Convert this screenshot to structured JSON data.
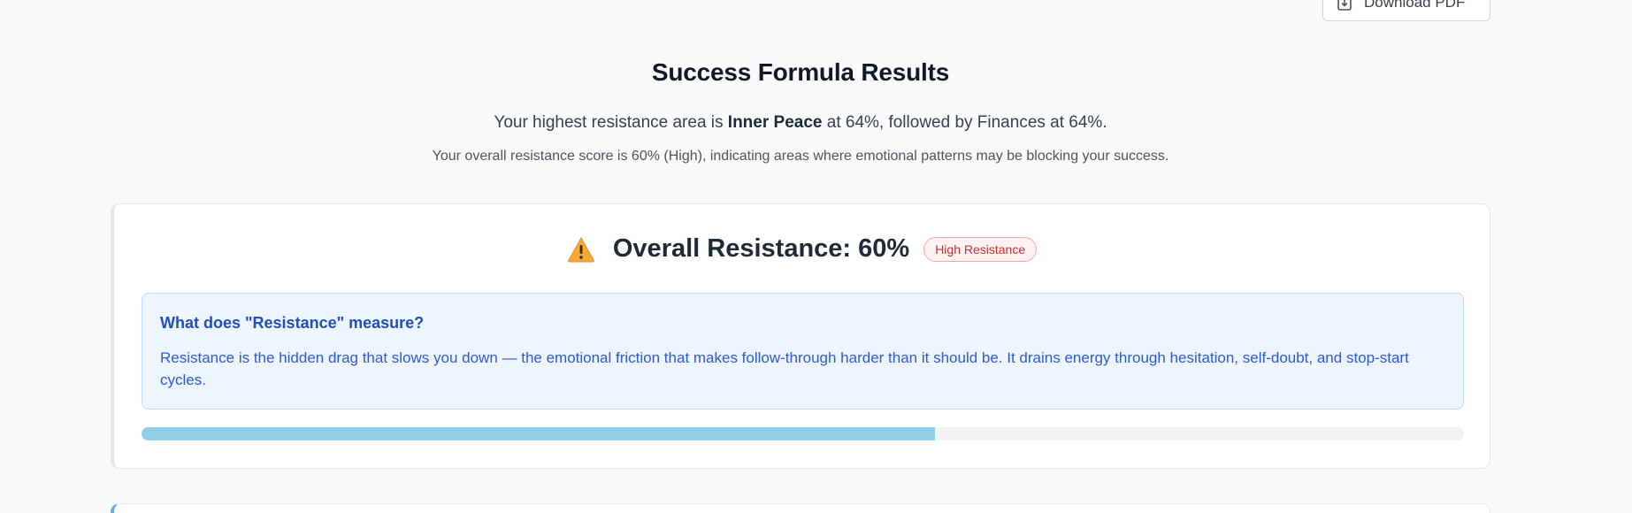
{
  "header": {
    "download_label": "Download PDF",
    "download_icon": "download-icon"
  },
  "results": {
    "title": "Success Formula Results",
    "summary_prefix": "Your highest resistance area is ",
    "summary_highlight": "Inner Peace",
    "summary_suffix": " at 64%, followed by Finances at 64%.",
    "overall_text": "Your overall resistance score is 60% (High), indicating areas where emotional patterns may be blocking your success."
  },
  "resistance_card": {
    "icon": "warning-icon",
    "title": "Overall Resistance: 60%",
    "badge": "High Resistance",
    "badge_color": "#c53030",
    "info_title": "What does \"Resistance\" measure?",
    "info_text": "Resistance is the hidden drag that slows you down — the emotional friction that makes follow-through harder than it should be. It drains energy through hesitation, self-doubt, and stop-start cycles.",
    "progress_value": 0.6,
    "progress_color": "#8ecfe6"
  }
}
